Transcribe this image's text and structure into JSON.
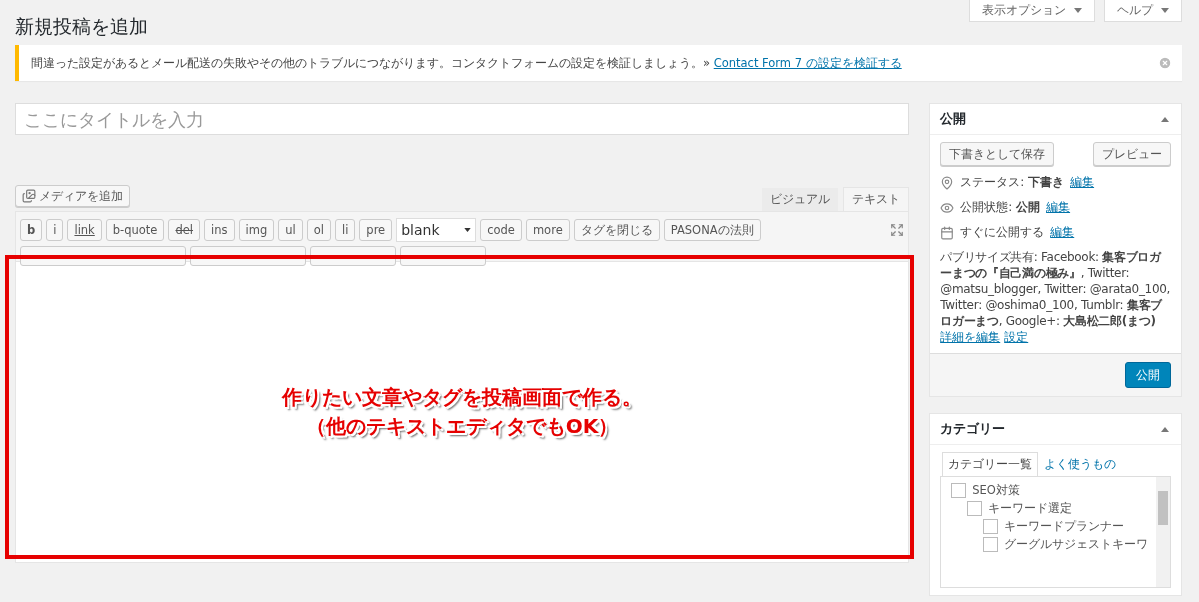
{
  "page_title": "新規投稿を追加",
  "screen_buttons": [
    {
      "label": "表示オプション"
    },
    {
      "label": "ヘルプ"
    }
  ],
  "notice": {
    "text": "間違った設定があるとメール配送の失敗やその他のトラブルにつながります。コンタクトフォームの設定を検証しましょう。»",
    "link": "Contact Form 7 の設定を検証する"
  },
  "title_field": {
    "placeholder": "ここにタイトルを入力"
  },
  "media_button": "メディアを追加",
  "editor_tabs": [
    {
      "label": "ビジュアル",
      "selected": false
    },
    {
      "label": "テキスト",
      "selected": true
    }
  ],
  "quicktags": [
    {
      "kind": "button",
      "label": "b"
    },
    {
      "kind": "button",
      "label": "i"
    },
    {
      "kind": "link",
      "label": "link"
    },
    {
      "kind": "button",
      "label": "b-quote"
    },
    {
      "kind": "strike",
      "label": "del"
    },
    {
      "kind": "button",
      "label": "ins"
    },
    {
      "kind": "button",
      "label": "img"
    },
    {
      "kind": "button",
      "label": "ul"
    },
    {
      "kind": "button",
      "label": "ol"
    },
    {
      "kind": "button",
      "label": "li"
    },
    {
      "kind": "button",
      "label": "pre"
    },
    {
      "kind": "select",
      "label": "blank"
    },
    {
      "kind": "button",
      "label": "code"
    },
    {
      "kind": "button",
      "label": "more"
    },
    {
      "kind": "button",
      "label": "タグを閉じる"
    },
    {
      "kind": "button",
      "label": "PASONAの法則"
    }
  ],
  "annotation": [
    "作りたい文章やタグを投稿画面で作る。",
    "（他のテキストエディタでもOK）"
  ],
  "publish": {
    "title": "公開",
    "expanded": true,
    "save_draft": "下書きとして保存",
    "preview": "プレビュー",
    "rows": [
      {
        "kind": "status",
        "text": "ステータス: **下書き**",
        "link": "編集"
      },
      {
        "kind": "visibility",
        "text": "公開状態: **公開**",
        "link": "編集"
      },
      {
        "kind": "schedule",
        "text": "すぐに公開する",
        "link": "編集"
      }
    ],
    "publicize": "パブリサイズ共有: Facebook: **集客ブロガーまつの『自己満の極み』**, Twitter: @matsu_blogger, Twitter: @arata0_100, Twitter: @oshima0_100, Tumblr: **集客ブロガーまつ**, Google+: **大島松二郎(まつ)**",
    "links": [
      "詳細を編集",
      "設定"
    ],
    "publish_button": "公開"
  },
  "categories": {
    "title": "カテゴリー",
    "expanded": true,
    "tabs": [
      {
        "label": "カテゴリー一覧",
        "selected": true
      },
      {
        "label": "よく使うもの",
        "selected": false
      }
    ],
    "items": [
      {
        "label": "SEO対策",
        "checked": false,
        "children": [
          {
            "label": "キーワード選定",
            "checked": false,
            "children": [
              {
                "label": "キーワードプランナー",
                "checked": false
              },
              {
                "label": "グーグルサジェストキーワ",
                "checked": false
              }
            ]
          }
        ]
      }
    ]
  }
}
